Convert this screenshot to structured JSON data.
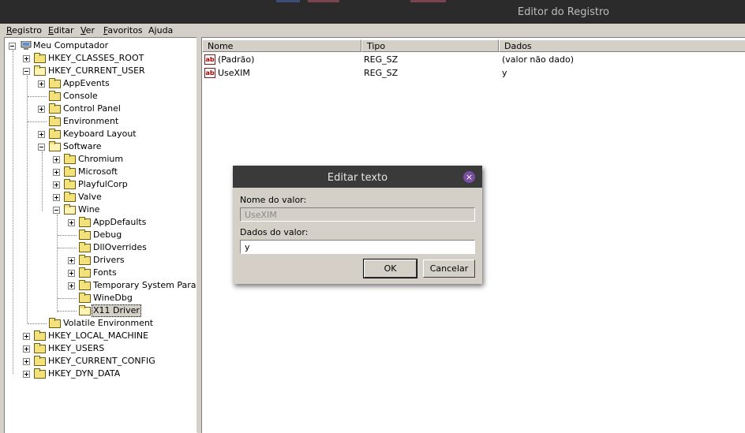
{
  "window": {
    "title": "Editor do Registro"
  },
  "menu": [
    {
      "label": "Registro"
    },
    {
      "label": "Editar"
    },
    {
      "label": "Ver"
    },
    {
      "label": "Favoritos"
    },
    {
      "label": "Ajuda"
    }
  ],
  "tree": {
    "root": "Meu Computador",
    "hkcr": "HKEY_CLASSES_ROOT",
    "hkcu": "HKEY_CURRENT_USER",
    "appevents": "AppEvents",
    "console": "Console",
    "control_panel": "Control Panel",
    "environment": "Environment",
    "keyboard_layout": "Keyboard Layout",
    "software": "Software",
    "chromium": "Chromium",
    "microsoft": "Microsoft",
    "playfulcorp": "PlayfulCorp",
    "valve": "Valve",
    "wine": "Wine",
    "appdefaults": "AppDefaults",
    "debug": "Debug",
    "dlloverrides": "DllOverrides",
    "drivers": "Drivers",
    "fonts": "Fonts",
    "temp_params": "Temporary System Parame",
    "winedbg": "WineDbg",
    "x11_driver": "X11 Driver",
    "volatile_env": "Volatile Environment",
    "hklm": "HKEY_LOCAL_MACHINE",
    "hku": "HKEY_USERS",
    "hkcc": "HKEY_CURRENT_CONFIG",
    "hkdd": "HKEY_DYN_DATA"
  },
  "list": {
    "headers": {
      "name": "Nome",
      "type": "Tipo",
      "data": "Dados"
    },
    "icon_text": "ab",
    "rows": [
      {
        "name": "(Padrão)",
        "type": "REG_SZ",
        "data": "(valor não dado)"
      },
      {
        "name": "UseXIM",
        "type": "REG_SZ",
        "data": "y"
      }
    ]
  },
  "dialog": {
    "title": "Editar texto",
    "close_glyph": "×",
    "value_name_label": "Nome do valor:",
    "value_name": "UseXIM",
    "value_data_label": "Dados do valor:",
    "value_data": "y",
    "ok_label": "OK",
    "cancel_label": "Cancelar"
  },
  "colors": {
    "titlebar": "#2b2b2b",
    "chrome": "#d4d0c8",
    "dialog_close": "#7a4ea0"
  }
}
